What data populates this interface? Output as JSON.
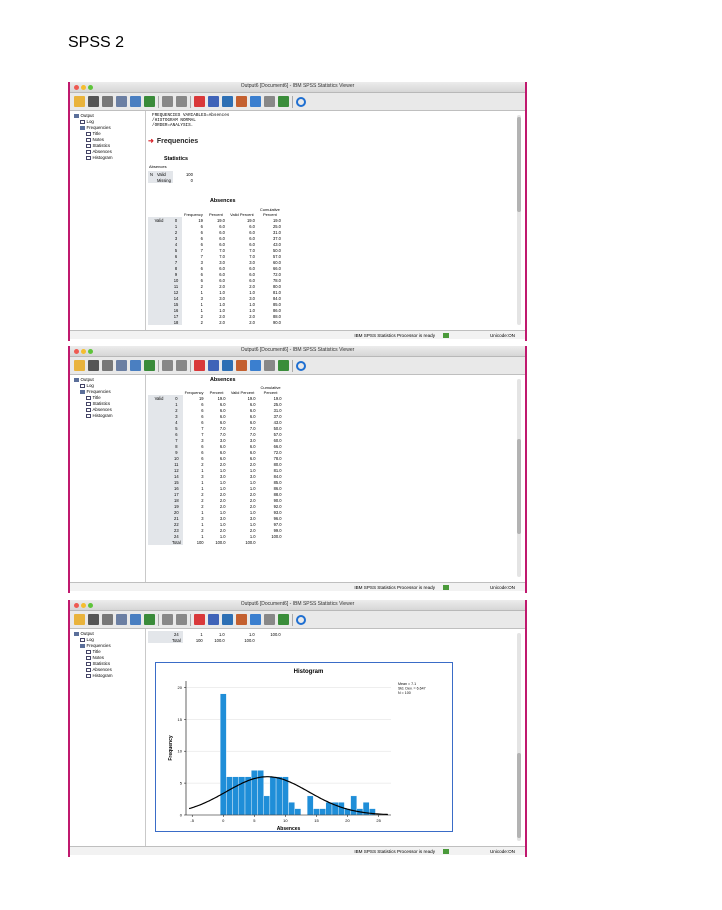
{
  "page_title": "SPSS 2",
  "window": {
    "title_1": "Output6 [Document6] - IBM SPSS Statistics Viewer",
    "title_2": "Output6 [Document6] - IBM SPSS Statistics Viewer",
    "title_3": "Output6 [Document6] - IBM SPSS Statistics Viewer",
    "status": "IBM SPSS Statistics Processor is ready",
    "unicode": "Unicode:ON"
  },
  "colors": {
    "accent": "#c0196e",
    "bar": "#1f8ed8",
    "curve": "#000000"
  },
  "nav": {
    "output": "Output",
    "log": "Log",
    "frequencies": "Frequencies",
    "title": "Title",
    "notes": "Notes",
    "statistics": "Statistics",
    "absences": "Absences",
    "histogram": "Histogram"
  },
  "toolbar_icons": [
    "open-folder-icon",
    "save-icon",
    "print-icon",
    "print-preview-icon",
    "export-icon",
    "recall-dialog-icon",
    "undo-icon",
    "redo-icon",
    "goto-case-icon",
    "goto-variable-icon",
    "variables-icon",
    "select-cases-icon",
    "weight-cases-icon",
    "value-labels-icon",
    "designate-window-icon",
    "search-icon"
  ],
  "syntax": [
    "FREQUENCIES VARIABLES=Absences",
    "  /HISTOGRAM NORMAL",
    "  /ORDER=ANALYSIS."
  ],
  "frequencies_heading": "Frequencies",
  "statistics": {
    "title": "Statistics",
    "variable": "Absences",
    "n_label": "N",
    "valid_label": "Valid",
    "missing_label": "Missing",
    "valid": "100",
    "missing": "0"
  },
  "freq_table": {
    "title": "Absences",
    "col_headers": [
      "Frequency",
      "Percent",
      "Valid Percent",
      "Cumulative Percent"
    ],
    "valid_label": "Valid",
    "total_label": "Total",
    "rows": [
      [
        "0",
        "19",
        "19.0",
        "19.0",
        "19.0"
      ],
      [
        "1",
        "6",
        "6.0",
        "6.0",
        "25.0"
      ],
      [
        "2",
        "6",
        "6.0",
        "6.0",
        "31.0"
      ],
      [
        "3",
        "6",
        "6.0",
        "6.0",
        "37.0"
      ],
      [
        "4",
        "6",
        "6.0",
        "6.0",
        "43.0"
      ],
      [
        "5",
        "7",
        "7.0",
        "7.0",
        "50.0"
      ],
      [
        "6",
        "7",
        "7.0",
        "7.0",
        "57.0"
      ],
      [
        "7",
        "3",
        "3.0",
        "3.0",
        "60.0"
      ],
      [
        "8",
        "6",
        "6.0",
        "6.0",
        "66.0"
      ],
      [
        "9",
        "6",
        "6.0",
        "6.0",
        "72.0"
      ],
      [
        "10",
        "6",
        "6.0",
        "6.0",
        "78.0"
      ],
      [
        "11",
        "2",
        "2.0",
        "2.0",
        "80.0"
      ],
      [
        "12",
        "1",
        "1.0",
        "1.0",
        "81.0"
      ],
      [
        "14",
        "3",
        "3.0",
        "3.0",
        "84.0"
      ],
      [
        "15",
        "1",
        "1.0",
        "1.0",
        "85.0"
      ],
      [
        "16",
        "1",
        "1.0",
        "1.0",
        "86.0"
      ],
      [
        "17",
        "2",
        "2.0",
        "2.0",
        "88.0"
      ],
      [
        "18",
        "2",
        "2.0",
        "2.0",
        "90.0"
      ],
      [
        "19",
        "2",
        "2.0",
        "2.0",
        "92.0"
      ],
      [
        "20",
        "1",
        "1.0",
        "1.0",
        "93.0"
      ],
      [
        "21",
        "3",
        "3.0",
        "3.0",
        "96.0"
      ],
      [
        "22",
        "1",
        "1.0",
        "1.0",
        "97.0"
      ],
      [
        "23",
        "2",
        "2.0",
        "2.0",
        "99.0"
      ],
      [
        "24",
        "1",
        "1.0",
        "1.0",
        "100.0"
      ]
    ],
    "total": [
      "100",
      "100.0",
      "100.0"
    ]
  },
  "chart_data": {
    "type": "bar",
    "title": "Histogram",
    "xlabel": "Absences",
    "ylabel": "Frequency",
    "x": [
      0,
      1,
      2,
      3,
      4,
      5,
      6,
      7,
      8,
      9,
      10,
      11,
      12,
      13,
      14,
      15,
      16,
      17,
      18,
      19,
      20,
      21,
      22,
      23,
      24
    ],
    "values": [
      19,
      6,
      6,
      6,
      6,
      7,
      7,
      3,
      6,
      6,
      6,
      2,
      1,
      0,
      3,
      1,
      1,
      2,
      2,
      2,
      1,
      3,
      1,
      2,
      1
    ],
    "xlim": [
      -6,
      27
    ],
    "ylim": [
      0,
      21
    ],
    "xticks": [
      -5,
      0,
      5,
      10,
      15,
      20,
      25
    ],
    "yticks": [
      0,
      5,
      10,
      15,
      20
    ],
    "normal_curve": {
      "mean": 7.1,
      "sd": 6.647,
      "n": 100
    },
    "legend_lines": [
      "Mean = 7.1",
      "Std. Dev. = 6.647",
      "N = 100"
    ]
  }
}
